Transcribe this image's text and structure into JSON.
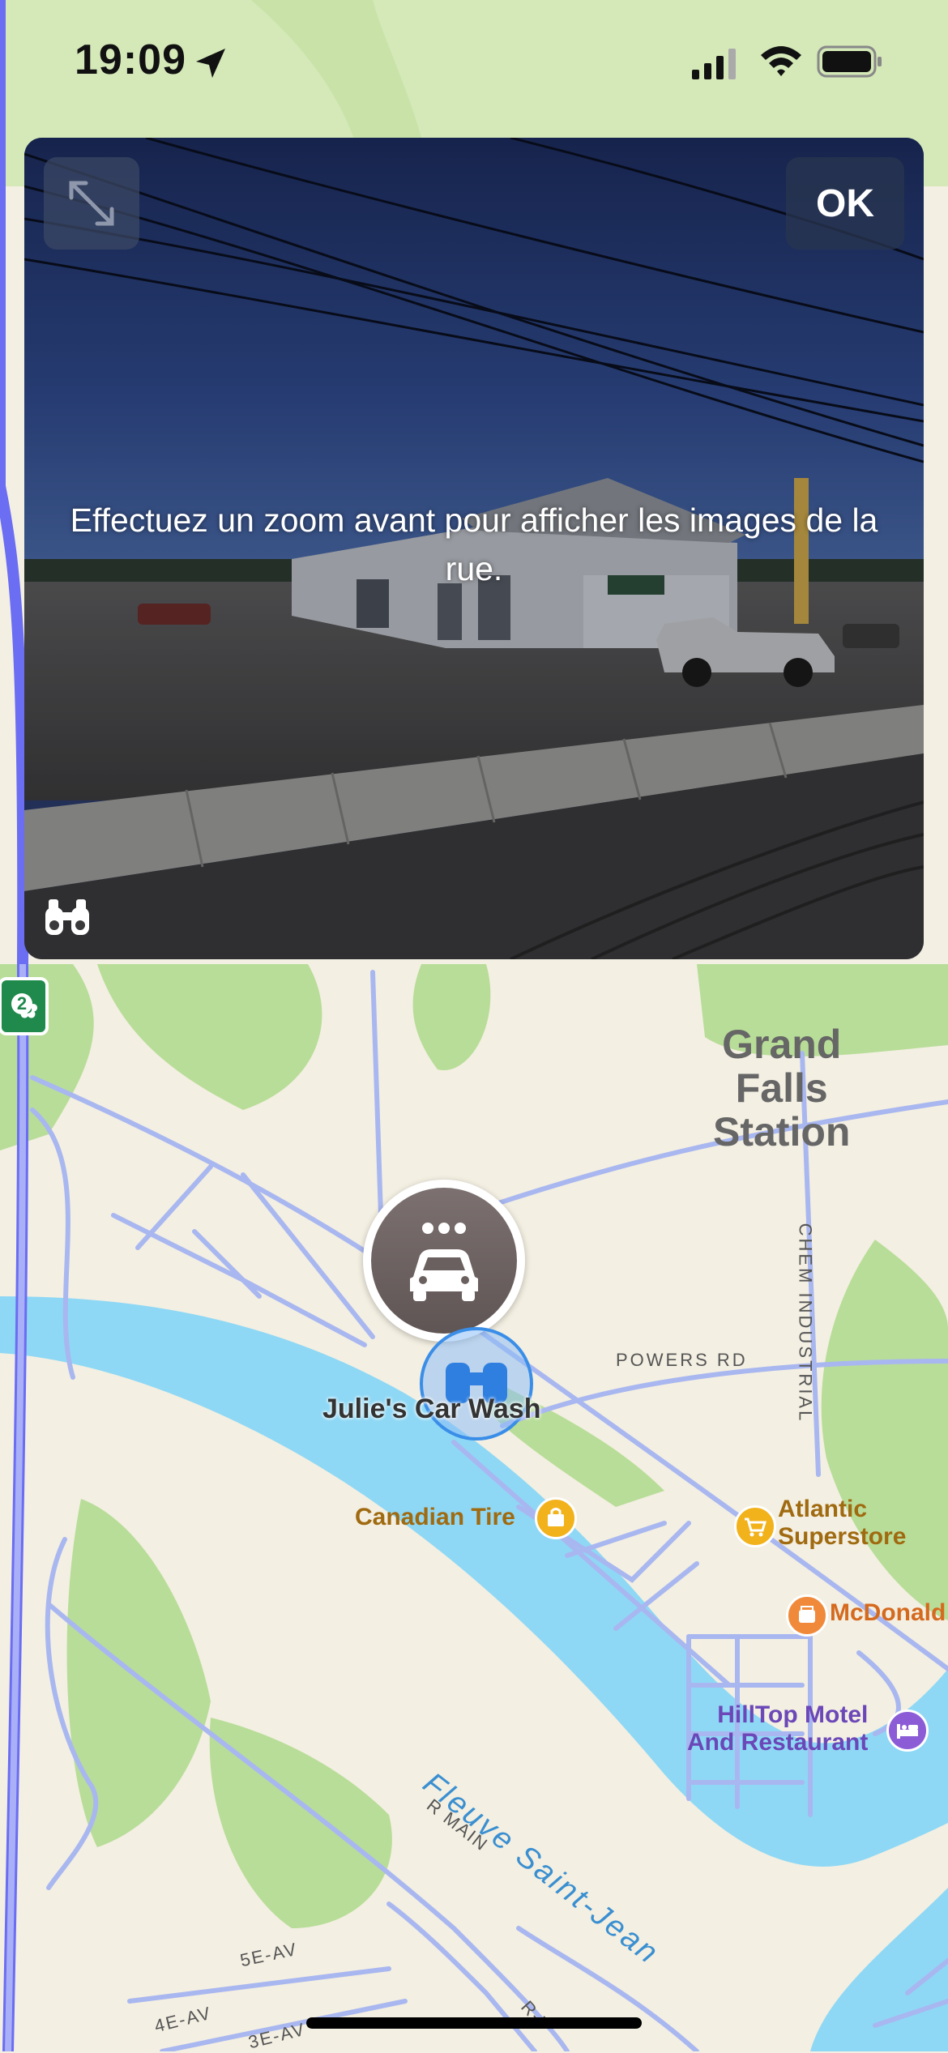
{
  "status_bar": {
    "time": "19:09",
    "icons": [
      "location-arrow-icon",
      "cellular-signal-icon",
      "wifi-icon",
      "battery-icon"
    ]
  },
  "look_around": {
    "ok_label": "OK",
    "zoom_message": "Effectuez un zoom avant pour afficher les images de la rue.",
    "expand_icon": "expand-arrows-icon",
    "binoculars_icon": "binoculars-icon"
  },
  "map": {
    "area_label": "Grand\nFalls\nStation",
    "pois": [
      {
        "name": "Julie's Car Wash",
        "icon": "car-wash-icon"
      },
      {
        "name": "Canadian Tire",
        "icon": "shopping-bag-icon",
        "color": "#f2b21b"
      },
      {
        "name": "Atlantic\nSuperstore",
        "icon": "shopping-cart-icon",
        "color": "#f2b21b"
      },
      {
        "name": "McDonald",
        "icon": "food-icon",
        "color": "#f08a3a"
      },
      {
        "name": "HillTop Motel\nAnd Restaurant",
        "icon": "bed-icon",
        "color": "#8b5cd6"
      }
    ],
    "roads": [
      "POWERS RD",
      "CHEM INDUSTRIAL",
      "R MAIN",
      "5E-AV",
      "4E-AV",
      "3E-AV",
      "R-T"
    ],
    "river": "Fleuve Saint-Jean",
    "highway_shield": "2",
    "colors": {
      "water": "#8ed8f5",
      "park": "#b8dd98",
      "land": "#f3efe2",
      "road": "#a9b7f0",
      "poi_text_brown": "#a06a10",
      "poi_text_purple": "#6b47b8"
    }
  }
}
